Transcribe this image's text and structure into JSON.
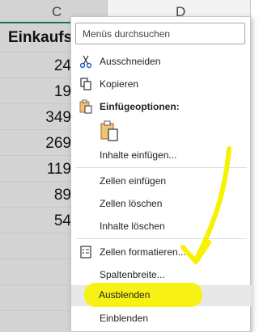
{
  "columns": {
    "c": "C",
    "d": "D"
  },
  "cells": {
    "title": "Einkaufs",
    "values": [
      "24",
      "19",
      "349",
      "269",
      "119",
      "89",
      "54"
    ]
  },
  "menu": {
    "search_placeholder": "Menüs durchsuchen",
    "items": [
      {
        "label": "Ausschneiden",
        "icon": "scissors-icon"
      },
      {
        "label": "Kopieren",
        "icon": "copy-icon"
      },
      {
        "label": "Einfügeoptionen:",
        "icon": "paste-options-icon"
      },
      {
        "label": "Inhalte einfügen...",
        "icon": ""
      },
      {
        "label": "Zellen einfügen",
        "icon": ""
      },
      {
        "label": "Zellen löschen",
        "icon": ""
      },
      {
        "label": "Inhalte löschen",
        "icon": ""
      },
      {
        "label": "Zellen formatieren...",
        "icon": "format-cells-icon"
      },
      {
        "label": "Spaltenbreite...",
        "icon": ""
      },
      {
        "label": "Ausblenden",
        "icon": ""
      },
      {
        "label": "Einblenden",
        "icon": ""
      }
    ]
  },
  "colors": {
    "highlight": "#f7f200",
    "selected_column": "#d3d3d3"
  }
}
